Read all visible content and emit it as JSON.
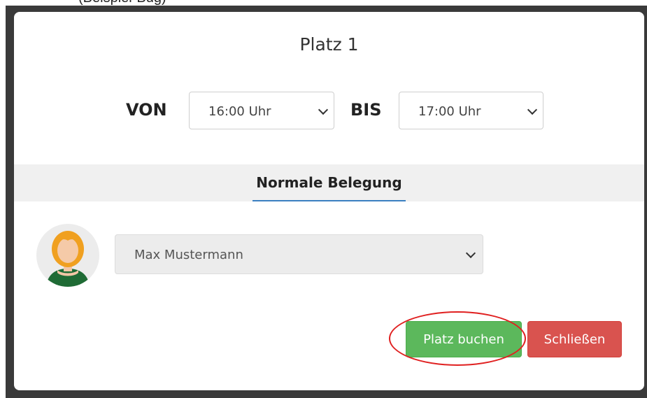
{
  "top_strip": {
    "cut_text": "(Beispiel-Bug)"
  },
  "modal": {
    "title": "Platz 1",
    "from_label": "VON",
    "from_value": "16:00 Uhr",
    "to_label": "BIS",
    "to_value": "17:00 Uhr",
    "tab_label": "Normale Belegung",
    "person_value": "Max Mustermann",
    "book_button": "Platz buchen",
    "close_button": "Schließen"
  },
  "colors": {
    "primary_green": "#5cb85c",
    "danger_red": "#d9534f",
    "tab_underline": "#3a7fc1",
    "highlight": "#e02020"
  },
  "icons": {
    "select_arrow": "chevron-down-icon",
    "avatar": "user-avatar-icon"
  }
}
